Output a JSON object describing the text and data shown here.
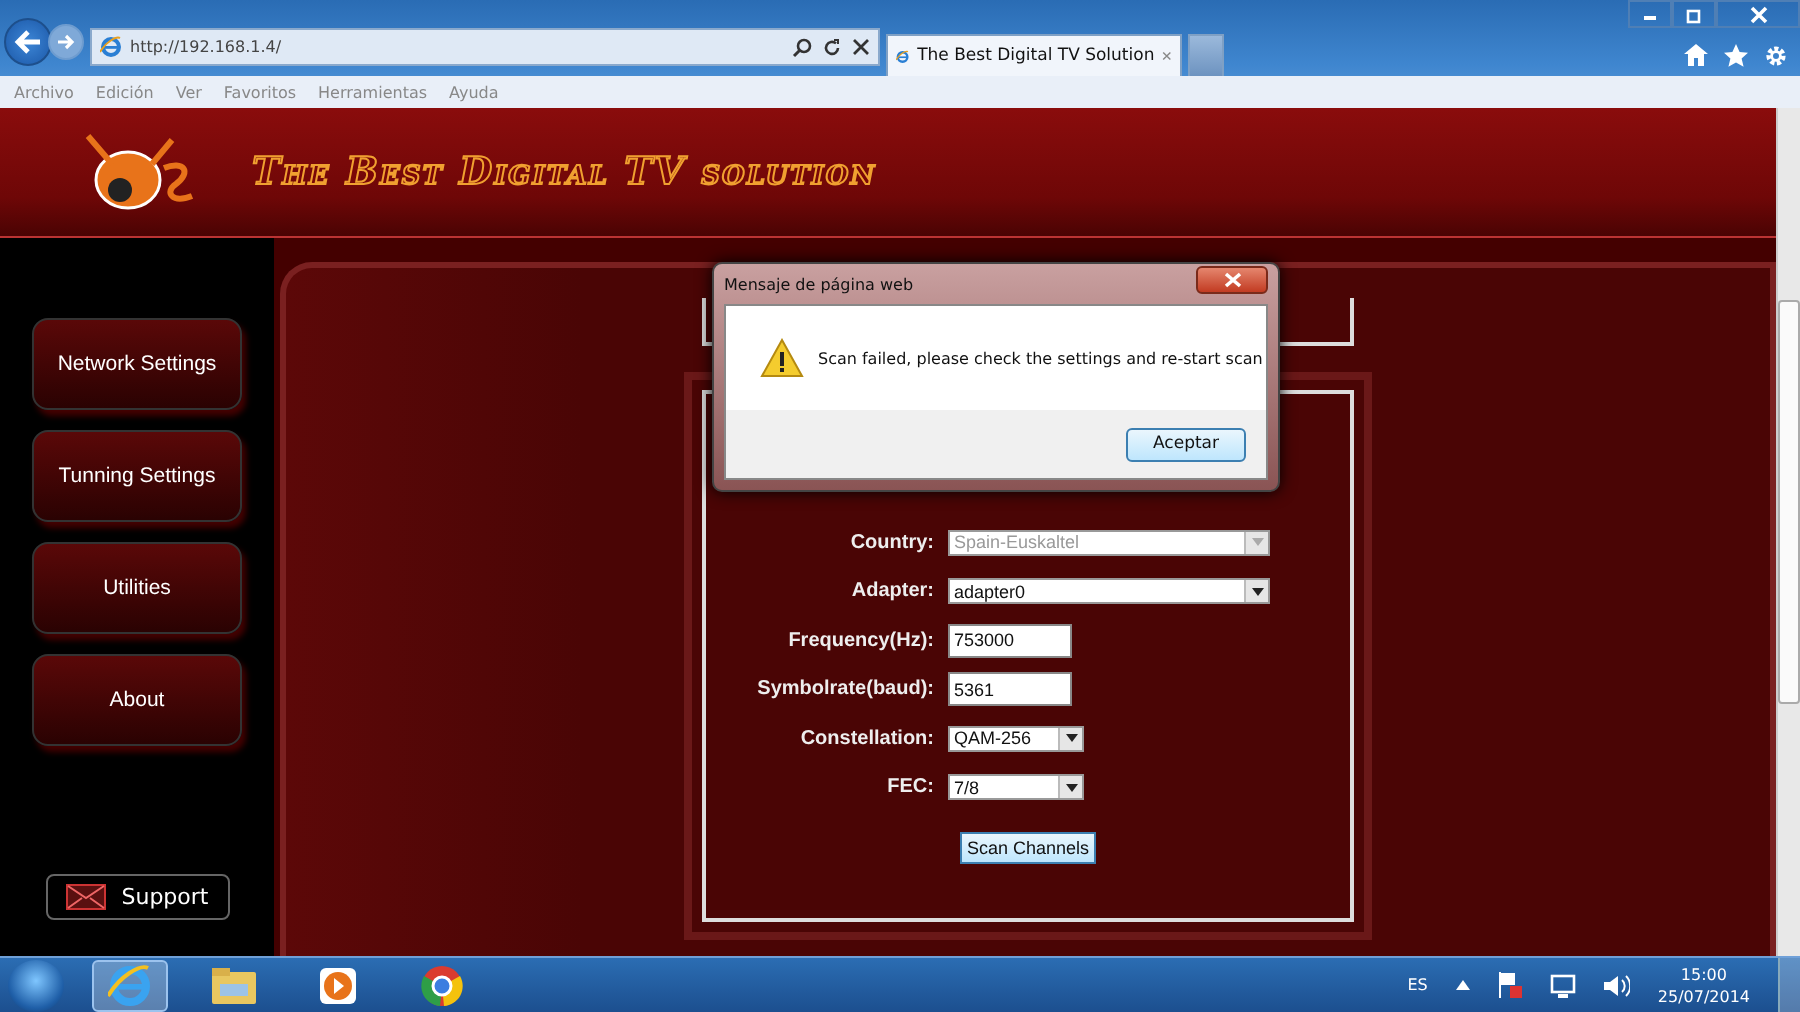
{
  "browser": {
    "address": "http://192.168.1.4/",
    "tabs": [
      {
        "label": "The Best Digital TV Solution",
        "selected": true
      }
    ],
    "menu": [
      "Archivo",
      "Edición",
      "Ver",
      "Favoritos",
      "Herramientas",
      "Ayuda"
    ]
  },
  "header": {
    "title": "The Best Digital TV solution"
  },
  "sidebar": {
    "items": [
      {
        "label": "Network Settings"
      },
      {
        "label": "Tunning Settings"
      },
      {
        "label": "Utilities"
      },
      {
        "label": "About"
      }
    ],
    "support": "Support"
  },
  "form": {
    "fields": [
      {
        "kind": "dropdown",
        "label": "Country:",
        "value": "Spain-Euskaltel",
        "disabled": true
      },
      {
        "kind": "dropdown",
        "label": "Adapter:",
        "value": "adapter0",
        "disabled": false
      },
      {
        "kind": "text",
        "label": "Frequency(Hz):",
        "value": "753000",
        "disabled": false
      },
      {
        "kind": "text",
        "label": "Symbolrate(baud):",
        "value": "5361",
        "disabled": false
      },
      {
        "kind": "combo",
        "label": "Constellation:",
        "value": "QAM-256",
        "disabled": false
      },
      {
        "kind": "combo",
        "label": "FEC:",
        "value": "7/8",
        "disabled": false
      }
    ],
    "button": "Scan Channels"
  },
  "dialog": {
    "title": "Mensaje de página web",
    "message": "Scan failed, please check the settings and re-start scan",
    "button": "Aceptar"
  },
  "taskbar": {
    "language": "ES",
    "time": "15:00",
    "date": "25/07/2014"
  }
}
